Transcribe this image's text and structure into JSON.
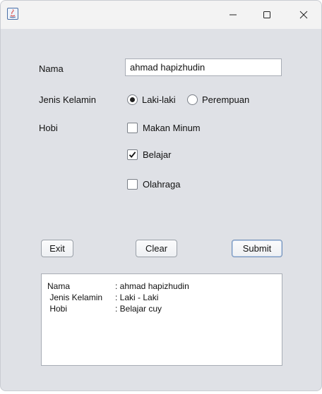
{
  "window": {
    "controls": {
      "minimize_icon": "minimize-icon",
      "maximize_icon": "maximize-icon",
      "close_icon": "close-icon"
    }
  },
  "form": {
    "nama_label": "Nama",
    "nama_value": "ahmad hapizhudin",
    "jenis_kelamin_label": "Jenis Kelamin",
    "gender_options": [
      {
        "label": "Laki-laki",
        "selected": true
      },
      {
        "label": "Perempuan",
        "selected": false
      }
    ],
    "hobi_label": "Hobi",
    "hobi_options": [
      {
        "label": "Makan Minum",
        "checked": false
      },
      {
        "label": "Belajar",
        "checked": true
      },
      {
        "label": "Olahraga",
        "checked": false
      }
    ]
  },
  "buttons": {
    "exit": "Exit",
    "clear": "Clear",
    "submit": "Submit"
  },
  "output": {
    "rows": [
      {
        "key": "Nama",
        "value": ": ahmad hapizhudin"
      },
      {
        "key": " Jenis Kelamin",
        "value": ": Laki - Laki"
      },
      {
        "key": " Hobi",
        "value": ": Belajar cuy"
      }
    ]
  },
  "colors": {
    "window_bg": "#dfe1e6",
    "titlebar_bg": "#f3f3f3",
    "submit_border": "#6f8fb8"
  }
}
